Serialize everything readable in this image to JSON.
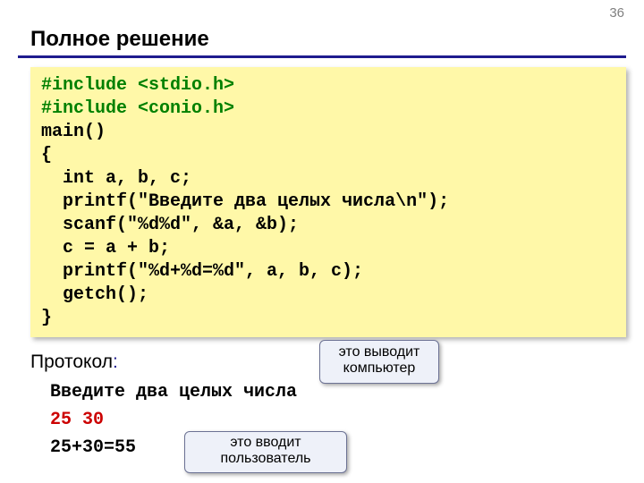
{
  "page_number": "36",
  "title": "Полное решение",
  "code": {
    "l1a": "#include ",
    "l1b": "<stdio.h>",
    "l2a": "#include ",
    "l2b": "<conio.h>",
    "l3": "main()",
    "l4": "{",
    "l5": "  int a, b, c;",
    "l6": "  printf(\"Введите два целых числа\\n\");",
    "l7": "  scanf(\"%d%d\", &a, &b);",
    "l8": "  c = a + b;",
    "l9": "  printf(\"%d+%d=%d\", a, b, c);",
    "l10": "  getch();",
    "l11": "}"
  },
  "protocol": {
    "label": "Протокол",
    "colon": ":",
    "line1": "Введите два целых числа",
    "line2": "25 30",
    "line3": "25+30=55"
  },
  "callouts": {
    "top_l1": "это выводит",
    "top_l2": "компьютер",
    "bottom_l1": "это вводит",
    "bottom_l2": "пользователь"
  }
}
